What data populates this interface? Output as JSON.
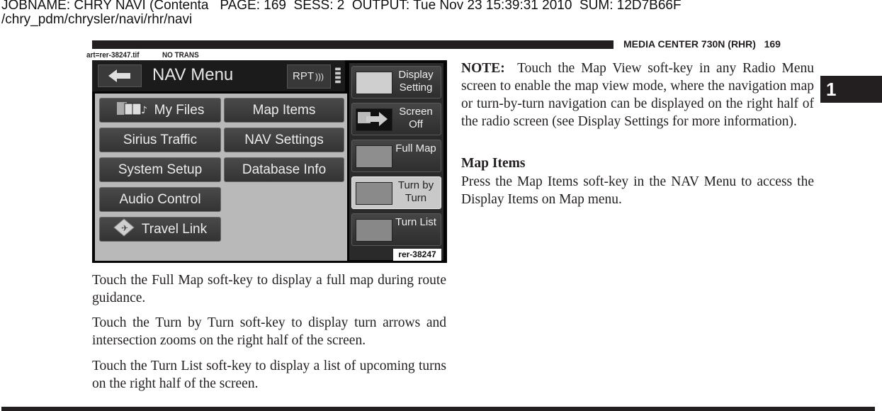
{
  "slug": {
    "line1": "JOBNAME: CHRY NAVI (Contenta   PAGE: 169  SESS: 2  OUTPUT: Tue Nov 23 15:39:31 2010  SUM: 12D7B66F",
    "line2": "/chry_pdm/chrysler/navi/rhr/navi"
  },
  "running_head": "MEDIA CENTER 730N (RHR)   169",
  "art_label": {
    "file": "art=rer-38247.tif",
    "trans": "NO TRANS"
  },
  "chapter_tab": "1",
  "screen": {
    "title": "NAV Menu",
    "back_icon": "left-arrow",
    "rpt_label": "RPT",
    "rpt_icon": "sound-waves",
    "menu_buttons": [
      {
        "label": "My Files",
        "icon": "files-music-icon"
      },
      {
        "label": "Map Items"
      },
      {
        "label": "Sirius Traffic"
      },
      {
        "label": "NAV Settings"
      },
      {
        "label": "System Setup"
      },
      {
        "label": "Database Info"
      },
      {
        "label": "Audio Control"
      },
      {
        "label": "Travel Link",
        "icon": "travel-link-icon"
      }
    ],
    "side_buttons": [
      {
        "label": "Display Setting",
        "active": false
      },
      {
        "label": "Screen Off",
        "active": false
      },
      {
        "label": "Full Map",
        "active": false
      },
      {
        "label": "Turn by Turn",
        "active": true
      },
      {
        "label": "Turn List",
        "active": false
      }
    ],
    "art_number": "rer-38247"
  },
  "left_column": [
    "Touch the Full Map soft-key to display a full map during route guidance.",
    "Touch the Turn by Turn soft-key to display turn arrows and intersection zooms on the right half of the screen.",
    "Touch the Turn List soft-key to display a list of upcoming turns on the right half of the screen."
  ],
  "right_column": {
    "note_label": "NOTE:",
    "note_text": "Touch the Map View soft-key in any Radio Menu screen to enable the map view mode, where the navigation map or turn-by-turn navigation can be displayed on the right half of the radio screen (see Display Settings for more information).",
    "heading": "Map Items",
    "body": "Press the Map Items soft-key in the NAV Menu to access the Display Items on Map menu."
  }
}
